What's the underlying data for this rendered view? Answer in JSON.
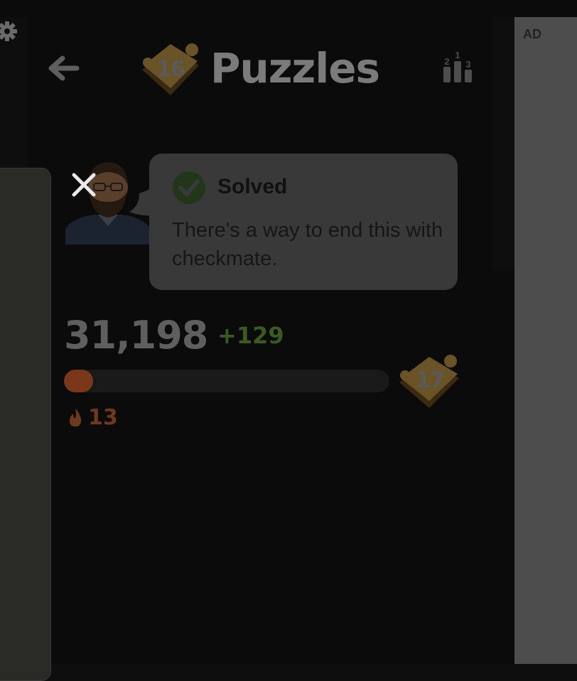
{
  "header": {
    "title": "Puzzles",
    "current_puzzle_level": "16",
    "back_icon": "arrow-left-icon",
    "leaderboard_icon": "leaderboard-podium-icon",
    "leaderboard_ranks": [
      "2",
      "1",
      "3"
    ],
    "settings_icon": "gear-icon"
  },
  "feedback": {
    "status": "Solved",
    "status_icon": "check-circle-icon",
    "message": "There's a way to end this with checkmate.",
    "close_icon": "close-icon",
    "coach_avatar": "coach-avatar"
  },
  "progress": {
    "score": "31,198",
    "delta": "+129",
    "next_level": "17",
    "fill_fraction": 0.09,
    "streak": "13",
    "streak_icon": "flame-icon"
  },
  "ad": {
    "label": "AD"
  },
  "colors": {
    "accent_green": "#3b5a1f",
    "streak_orange": "#7a3719",
    "bubble": "#393939",
    "background": "#0b0b0b"
  }
}
